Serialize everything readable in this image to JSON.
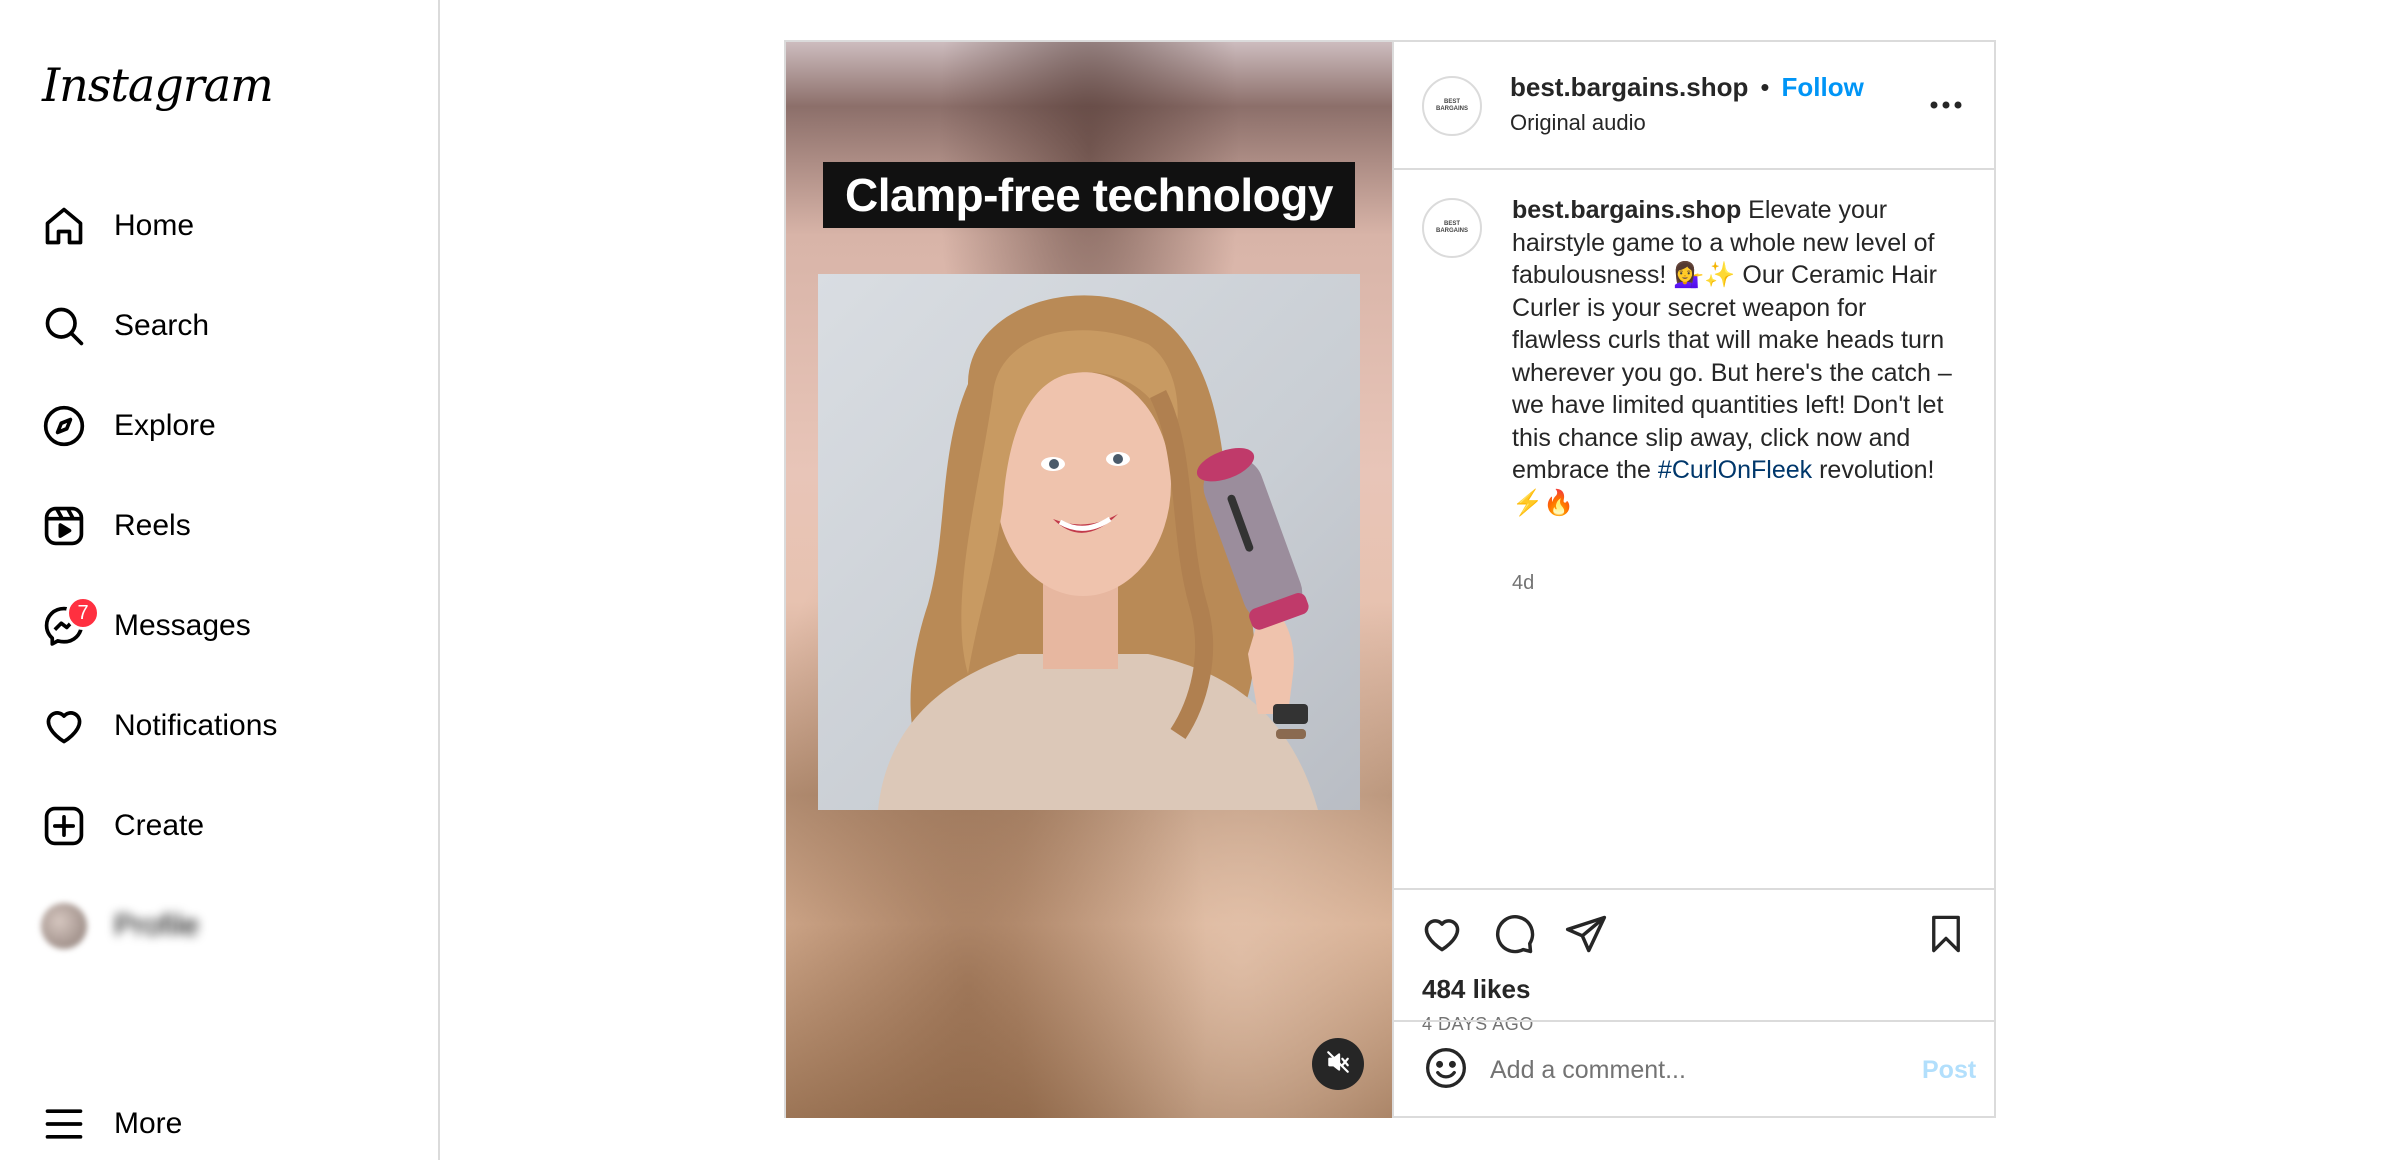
{
  "sidebar": {
    "logo": "Instagram",
    "items": [
      {
        "label": "Home"
      },
      {
        "label": "Search"
      },
      {
        "label": "Explore"
      },
      {
        "label": "Reels"
      },
      {
        "label": "Messages",
        "badge": "7"
      },
      {
        "label": "Notifications"
      },
      {
        "label": "Create"
      },
      {
        "label": "Profile"
      },
      {
        "label": "More"
      }
    ]
  },
  "post": {
    "media": {
      "banner_text": "Clamp-free technology"
    },
    "header": {
      "username": "best.bargains.shop",
      "separator": "•",
      "follow_label": "Follow",
      "audio": "Original audio"
    },
    "caption": {
      "username": "best.bargains.shop",
      "text_before_hashtag": "Elevate your hairstyle game to a whole new level of fabulousness! 💁‍♀️✨ Our Ceramic Hair Curler is your secret weapon for flawless curls that will make heads turn wherever you go. But here's the catch – we have limited quantities left! Don't let this chance slip away, click now and embrace the ",
      "hashtag": "#CurlOnFleek",
      "text_after_hashtag": " revolution! ⚡🔥",
      "time": "4d"
    },
    "likes": "484 likes",
    "date": "4 DAYS AGO",
    "comment": {
      "placeholder": "Add a comment...",
      "post_label": "Post"
    }
  },
  "colors": {
    "accent": "#0095f6",
    "badge": "#ff3040",
    "post_disabled": "#b2dffc"
  }
}
